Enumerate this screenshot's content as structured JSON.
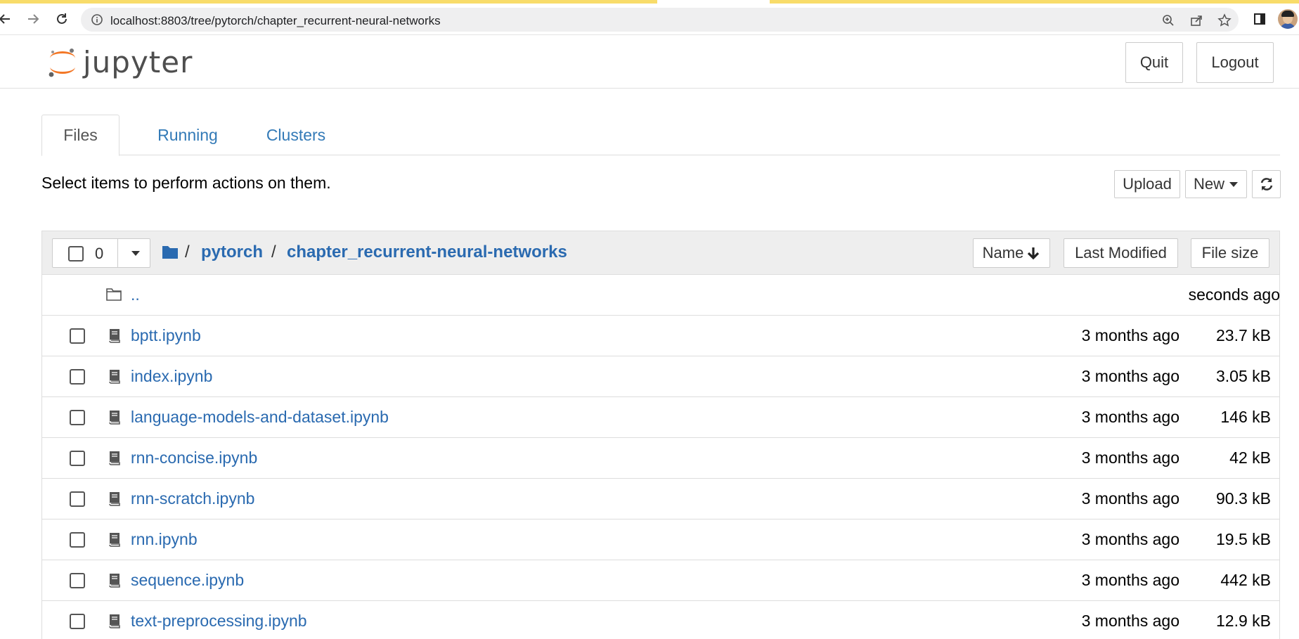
{
  "browser": {
    "url": "localhost:8803/tree/pytorch/chapter_recurrent-neural-networks",
    "back_icon": "arrow-left-icon",
    "forward_icon": "arrow-right-icon",
    "reload_icon": "reload-icon"
  },
  "header": {
    "logo_text": "jupyter",
    "quit_label": "Quit",
    "logout_label": "Logout"
  },
  "tabs": [
    {
      "label": "Files",
      "active": true
    },
    {
      "label": "Running",
      "active": false
    },
    {
      "label": "Clusters",
      "active": false
    }
  ],
  "toolbar": {
    "hint": "Select items to perform actions on them.",
    "upload_label": "Upload",
    "new_label": "New",
    "refresh_icon": "refresh-icon"
  },
  "list_header": {
    "selected_count": "0",
    "breadcrumb": {
      "root_sep": "/",
      "parts": [
        "pytorch",
        "chapter_recurrent-neural-networks"
      ],
      "sep": "/"
    },
    "sort_name": "Name",
    "sort_modified": "Last Modified",
    "sort_size": "File size"
  },
  "parent_row": {
    "name": "..",
    "modified": "seconds ago"
  },
  "files": [
    {
      "name": "bptt.ipynb",
      "modified": "3 months ago",
      "size": "23.7 kB"
    },
    {
      "name": "index.ipynb",
      "modified": "3 months ago",
      "size": "3.05 kB"
    },
    {
      "name": "language-models-and-dataset.ipynb",
      "modified": "3 months ago",
      "size": "146 kB"
    },
    {
      "name": "rnn-concise.ipynb",
      "modified": "3 months ago",
      "size": "42 kB"
    },
    {
      "name": "rnn-scratch.ipynb",
      "modified": "3 months ago",
      "size": "90.3 kB"
    },
    {
      "name": "rnn.ipynb",
      "modified": "3 months ago",
      "size": "19.5 kB"
    },
    {
      "name": "sequence.ipynb",
      "modified": "3 months ago",
      "size": "442 kB"
    },
    {
      "name": "text-preprocessing.ipynb",
      "modified": "3 months ago",
      "size": "12.9 kB"
    }
  ],
  "colors": {
    "link": "#2a6ab0",
    "tab_link": "#337ab7",
    "logo_orange": "#f37726",
    "header_bg": "#eeeeee"
  }
}
